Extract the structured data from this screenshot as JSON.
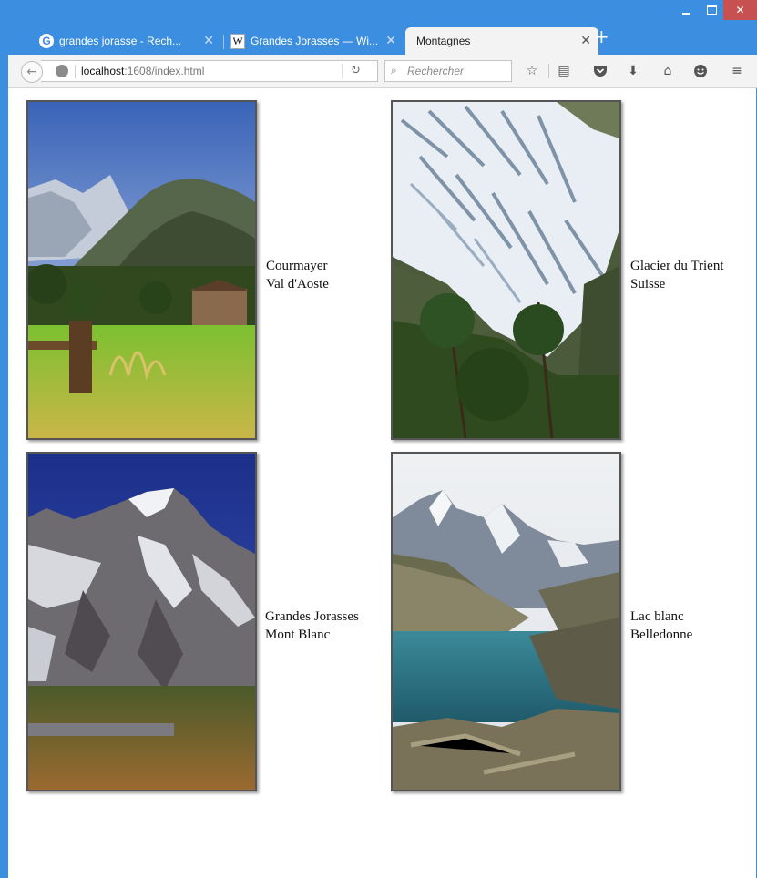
{
  "browser": {
    "tabs": [
      {
        "title": "grandes jorasse - Rech...",
        "favicon": "google-icon",
        "favicon_text": "G",
        "active": false
      },
      {
        "title": "Grandes Jorasses — Wi...",
        "favicon": "wikipedia-icon",
        "favicon_text": "W",
        "active": false
      },
      {
        "title": "Montagnes",
        "favicon": "",
        "active": true
      }
    ],
    "new_tab_label": "+",
    "url_host": "localhost",
    "url_rest": ":1608/index.html",
    "search_placeholder": "Rechercher",
    "accent": "#3c8fe0"
  },
  "page": {
    "cards": [
      {
        "line1": "Courmayer",
        "line2": "Val d'Aoste",
        "scene": "meadow-valley"
      },
      {
        "line1": "Glacier du Trient",
        "line2": "Suisse",
        "scene": "glacier"
      },
      {
        "line1": "Grandes Jorasses",
        "line2": "Mont Blanc",
        "scene": "rocky-peak"
      },
      {
        "line1": "Lac blanc",
        "line2": "Belledonne",
        "scene": "mountain-lake"
      }
    ]
  }
}
